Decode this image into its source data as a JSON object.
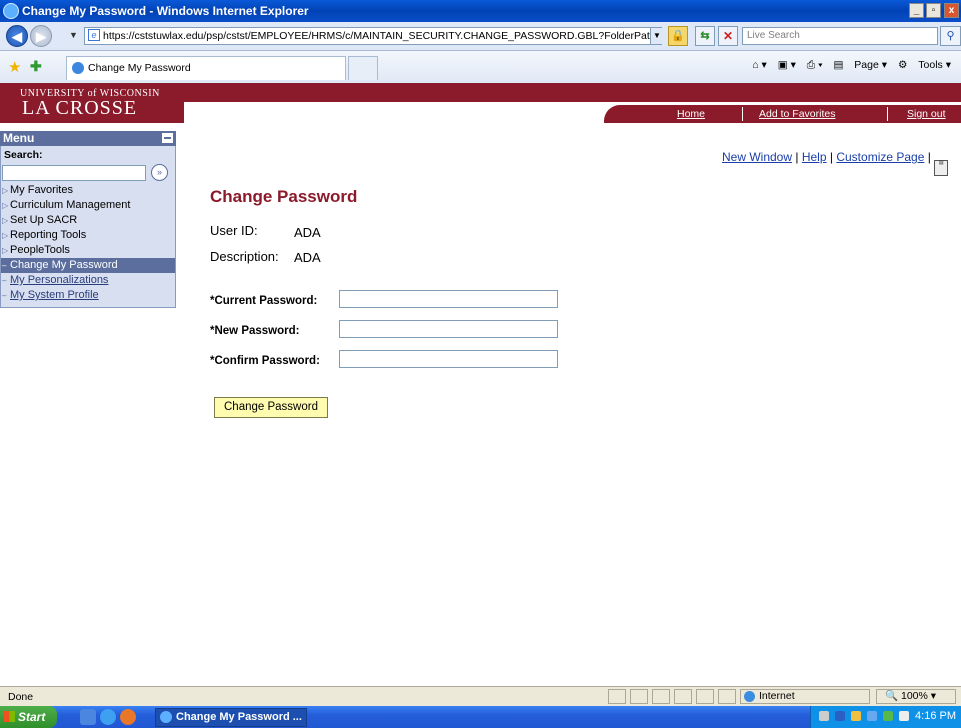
{
  "window": {
    "title": "Change My Password - Windows Internet Explorer",
    "min": "_",
    "max": "▫",
    "close": "x"
  },
  "addressbar": {
    "url": "https://cststuwlax.edu/psp/cstst/EMPLOYEE/HRMS/c/MAINTAIN_SECURITY.CHANGE_PASSWORD.GBL?FolderPath=PO",
    "search_placeholder": "Live Search"
  },
  "tab": {
    "label": "Change My Password"
  },
  "commandbar": {
    "page": "Page",
    "tools": "Tools"
  },
  "banner": {
    "logo_line1": "UNIVERSITY of WISCONSIN",
    "logo_line2": "LA CROSSE",
    "links": [
      "Home",
      "Add to Favorites",
      "Sign out"
    ]
  },
  "menu": {
    "title": "Menu",
    "search_label": "Search:",
    "items": [
      {
        "label": "My Favorites",
        "type": "folder"
      },
      {
        "label": "Curriculum Management",
        "type": "folder"
      },
      {
        "label": "Set Up SACR",
        "type": "folder"
      },
      {
        "label": "Reporting Tools",
        "type": "folder"
      },
      {
        "label": "PeopleTools",
        "type": "folder"
      },
      {
        "label": "Change My Password",
        "type": "selected"
      },
      {
        "label": "My Personalizations",
        "type": "link"
      },
      {
        "label": "My System Profile",
        "type": "link"
      }
    ]
  },
  "toplinks": {
    "new_window": "New Window",
    "help": "Help",
    "customize": "Customize Page",
    "sep": "|"
  },
  "form": {
    "title": "Change Password",
    "userid_label": "User ID:",
    "userid_value": "ADA",
    "desc_label": "Description:",
    "desc_value": "ADA",
    "current_label": "*Current Password:",
    "new_label": "*New Password:",
    "confirm_label": "*Confirm Password:",
    "submit_label": "Change Password"
  },
  "status": {
    "text": "Done",
    "zone": "Internet",
    "zoom": "100%"
  },
  "taskbar": {
    "start": "Start",
    "task": "Change My Password ...",
    "clock": "4:16 PM"
  }
}
